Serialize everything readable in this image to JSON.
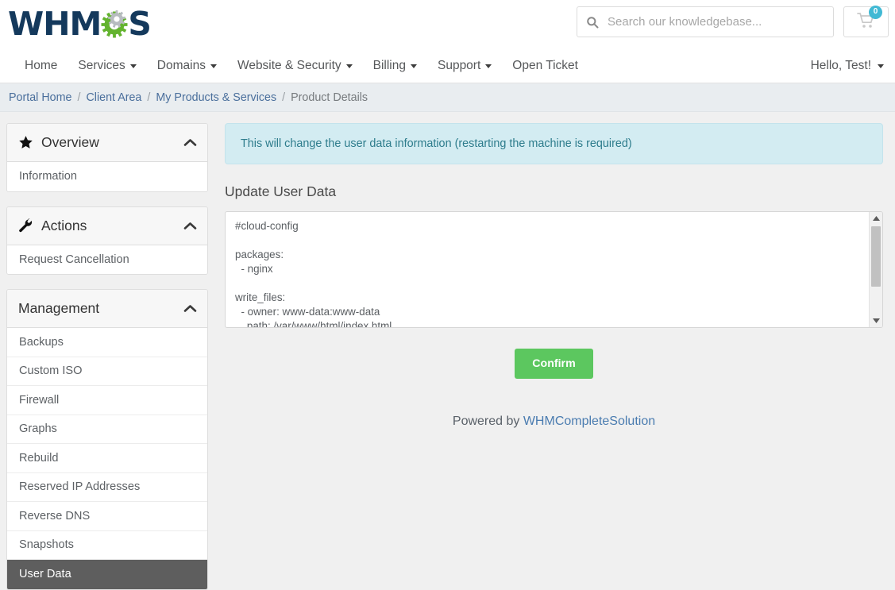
{
  "brand": {
    "logo_text_1": "WHM",
    "logo_text_2": "S",
    "gear_icon": "gear-icon",
    "colors": {
      "logo_navy": "#14395c",
      "logo_green": "#63b32e",
      "accent_teal": "#41b9d4",
      "confirm_green": "#5cc75f",
      "active_gray": "#5e5e5e",
      "alert_bg": "#d3ecf2",
      "alert_text": "#2d7c8c",
      "link_blue": "#4a6f9c"
    }
  },
  "search": {
    "placeholder": "Search our knowledgebase...",
    "value": "",
    "icon": "search-icon"
  },
  "cart": {
    "icon": "shopping-cart-icon",
    "count": "0"
  },
  "nav": {
    "items": [
      {
        "label": "Home",
        "has_caret": false
      },
      {
        "label": "Services",
        "has_caret": true
      },
      {
        "label": "Domains",
        "has_caret": true
      },
      {
        "label": "Website & Security",
        "has_caret": true
      },
      {
        "label": "Billing",
        "has_caret": true
      },
      {
        "label": "Support",
        "has_caret": true
      },
      {
        "label": "Open Ticket",
        "has_caret": false
      }
    ],
    "account_label": "Hello, Test!"
  },
  "breadcrumb": {
    "items": [
      {
        "label": "Portal Home",
        "current": false
      },
      {
        "label": "Client Area",
        "current": false
      },
      {
        "label": "My Products & Services",
        "current": false
      },
      {
        "label": "Product Details",
        "current": true
      }
    ],
    "separator": "/"
  },
  "sidebar": {
    "panels": [
      {
        "title": "Overview",
        "icon": "star-icon",
        "collapse_icon": "chevron-up-icon",
        "items": [
          {
            "label": "Information",
            "active": false
          }
        ]
      },
      {
        "title": "Actions",
        "icon": "wrench-icon",
        "collapse_icon": "chevron-up-icon",
        "items": [
          {
            "label": "Request Cancellation",
            "active": false
          }
        ]
      },
      {
        "title": "Management",
        "icon": "",
        "collapse_icon": "chevron-up-icon",
        "items": [
          {
            "label": "Backups",
            "active": false
          },
          {
            "label": "Custom ISO",
            "active": false
          },
          {
            "label": "Firewall",
            "active": false
          },
          {
            "label": "Graphs",
            "active": false
          },
          {
            "label": "Rebuild",
            "active": false
          },
          {
            "label": "Reserved IP Addresses",
            "active": false
          },
          {
            "label": "Reverse DNS",
            "active": false
          },
          {
            "label": "Snapshots",
            "active": false
          },
          {
            "label": "User Data",
            "active": true
          }
        ]
      }
    ]
  },
  "main": {
    "alert_text": "This will change the user data information (restarting the machine is required)",
    "section_title": "Update User Data",
    "userdata_value": "#cloud-config\n\npackages:\n  - nginx\n\nwrite_files:\n  - owner: www-data:www-data\n    path: /var/www/html/index.html",
    "scrollbar": {
      "up_arrow_icon": "triangle-up-icon",
      "down_arrow_icon": "triangle-down-icon"
    },
    "confirm_label": "Confirm"
  },
  "footer": {
    "powered_prefix": "Powered by ",
    "powered_link": "WHMCompleteSolution"
  }
}
